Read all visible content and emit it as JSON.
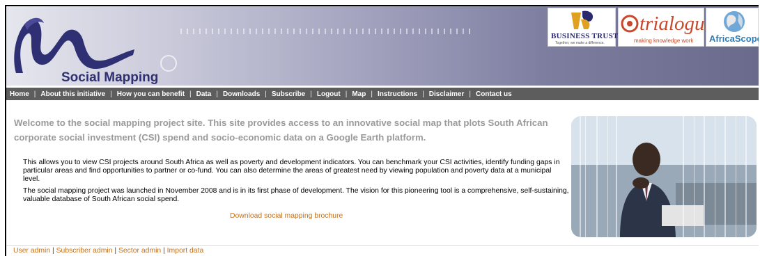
{
  "header": {
    "logo_text": "Social Mapping",
    "partners": [
      {
        "name": "BUSINESS TRUST",
        "tagline": "Together, we make a difference."
      },
      {
        "name": "trialogue",
        "tagline": "making knowledge work"
      },
      {
        "name": "AfricaScope"
      }
    ]
  },
  "nav": {
    "items": [
      {
        "label": "Home"
      },
      {
        "label": "About this initiative"
      },
      {
        "label": "How you can benefit"
      },
      {
        "label": "Data"
      },
      {
        "label": "Downloads"
      },
      {
        "label": "Subscribe"
      },
      {
        "label": "Logout"
      },
      {
        "label": "Map"
      },
      {
        "label": "Instructions"
      },
      {
        "label": "Disclaimer"
      },
      {
        "label": "Contact us"
      }
    ],
    "separator": "|"
  },
  "main": {
    "welcome": "Welcome to the social mapping project site. This site provides access to an innovative social map that plots South African corporate social investment (CSI) spend and socio-economic data on a Google Earth platform.",
    "paragraph1": "This allows you to view CSI projects around South Africa as well as poverty and development indicators. You can benchmark your CSI activities, identify funding gaps in particular areas and find opportunities to partner or co-fund. You can also determine the areas of greatest need by viewing population and poverty data at a municipal level.",
    "paragraph2": "The social mapping project was launched in November 2008 and is in its first phase of development. The vision for this pioneering tool is a comprehensive, self-sustaining, valuable database of South African social spend.",
    "download_link": "Download social mapping brochure"
  },
  "footer": {
    "links": [
      {
        "label": "User admin"
      },
      {
        "label": "Subscriber admin"
      },
      {
        "label": "Sector admin"
      },
      {
        "label": "Import data"
      }
    ],
    "separator": "|"
  },
  "colors": {
    "nav_bg": "#5d5d5d",
    "link": "#c3701c",
    "welcome_text": "#9a9a9a",
    "logo_blue": "#2f2f74"
  }
}
